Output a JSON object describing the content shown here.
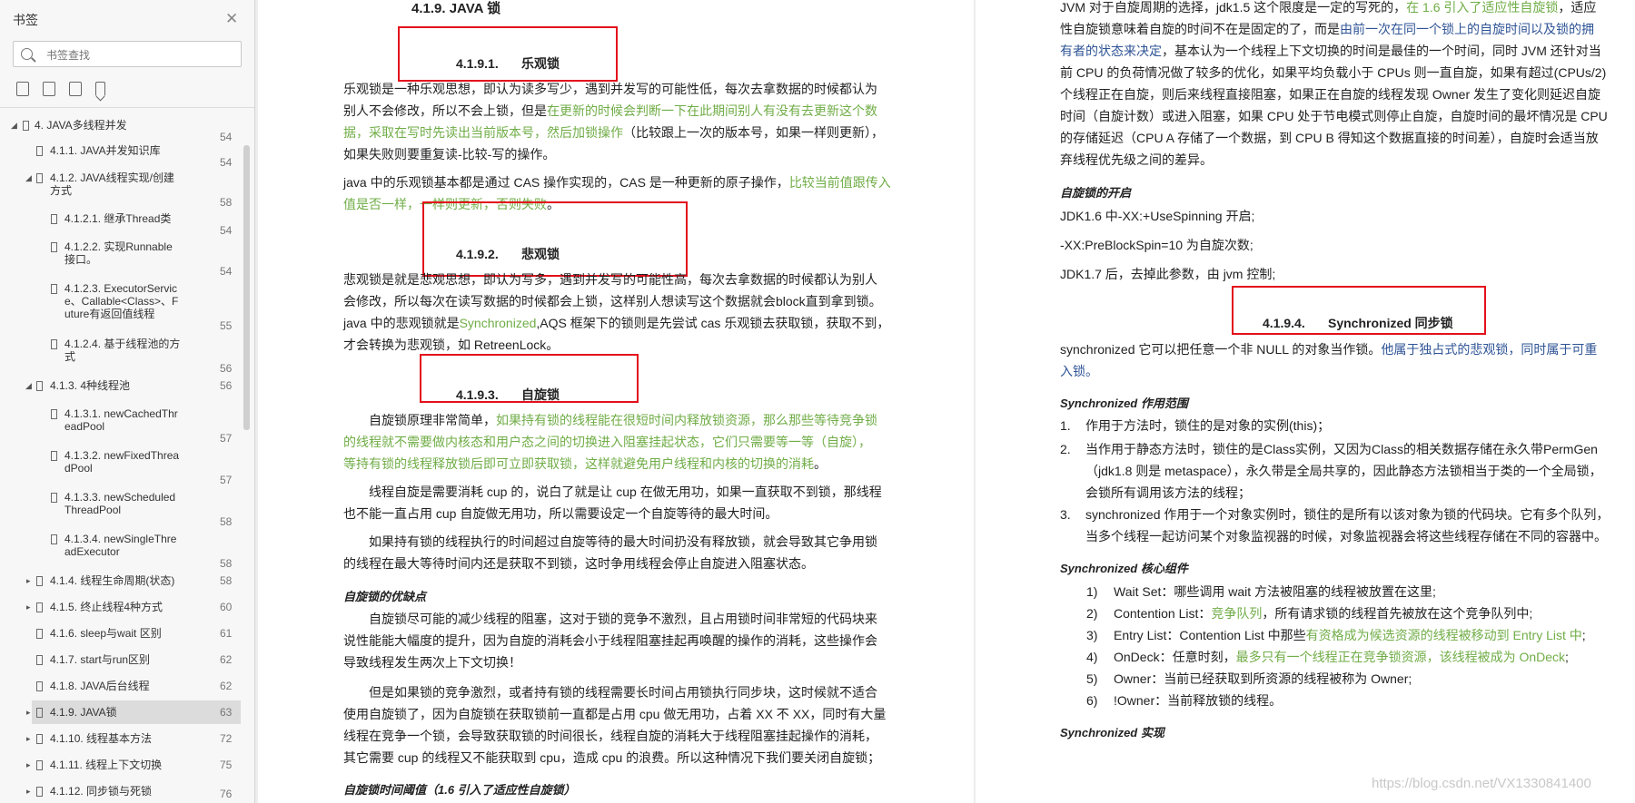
{
  "sidebar": {
    "title": "书签",
    "close_icon": "close-icon",
    "search_placeholder": "书签查找",
    "tools": [
      "expand-all-icon",
      "collapse-all-icon",
      "add-bookmark-icon",
      "bookmark-icon"
    ],
    "items": [
      {
        "label": "4. JAVA多线程并发",
        "page": "54",
        "arrow": "◢"
      },
      {
        "label": "4.1.1. JAVA并发知识库",
        "page": "54",
        "arrow": ""
      },
      {
        "label": "4.1.2. JAVA线程实现/创建",
        "label2": "方式",
        "page": "58",
        "arrow": "◢"
      },
      {
        "label": "4.1.2.1. 继承Thread类",
        "page": "54",
        "arrow": ""
      },
      {
        "label": "4.1.2.2. 实现Runnable",
        "label2": "接口。",
        "page": "54",
        "arrow": ""
      },
      {
        "label": "4.1.2.3. ExecutorServic",
        "label2": "e、Callable<Class>、F",
        "label3": "uture有返回值线程",
        "page": "55",
        "arrow": ""
      },
      {
        "label": "4.1.2.4. 基于线程池的方",
        "label2": "式",
        "page": "56",
        "arrow": ""
      },
      {
        "label": "4.1.3. 4种线程池",
        "page": "56",
        "arrow": "◢"
      },
      {
        "label": "4.1.3.1. newCachedThr",
        "label2": "eadPool",
        "page": "57",
        "arrow": ""
      },
      {
        "label": "4.1.3.2. newFixedThrea",
        "label2": "dPool",
        "page": "57",
        "arrow": ""
      },
      {
        "label": "4.1.3.3. newScheduled",
        "label2": "ThreadPool",
        "page": "58",
        "arrow": ""
      },
      {
        "label": "4.1.3.4. newSingleThre",
        "label2": "adExecutor",
        "page": "58",
        "arrow": ""
      },
      {
        "label": "4.1.4. 线程生命周期(状态)",
        "page": "58",
        "arrow": "▸"
      },
      {
        "label": "4.1.5. 终止线程4种方式",
        "page": "60",
        "arrow": "▸"
      },
      {
        "label": "4.1.6. sleep与wait 区别",
        "page": "61",
        "arrow": ""
      },
      {
        "label": "4.1.7. start与run区别",
        "page": "62",
        "arrow": ""
      },
      {
        "label": "4.1.8. JAVA后台线程",
        "page": "62",
        "arrow": ""
      },
      {
        "label": "4.1.9. JAVA锁",
        "page": "63",
        "arrow": "▸"
      },
      {
        "label": "4.1.10. 线程基本方法",
        "page": "72",
        "arrow": "▸"
      },
      {
        "label": "4.1.11. 线程上下文切换",
        "page": "75",
        "arrow": "▸"
      },
      {
        "label": "4.1.12. 同步锁与死锁",
        "page": "76",
        "arrow": "▸"
      }
    ]
  },
  "page1": {
    "top_heading": "4.1.9.  JAVA 锁",
    "h_optimistic_num": "4.1.9.1.",
    "h_optimistic": "乐观锁",
    "p1_a": "乐观锁是一种乐观思想，即认为读多写少，遇到并发写的可能性低，每次去拿数据的时候都认为",
    "p1_b1": "别人不会修改，所以不会上锁，但是",
    "p1_b2": "在更新的时候会判断一下在此期间别人有没有去更新这个数",
    "p1_c1": "据，采取在写时先读出当前版本号，然后加锁操作",
    "p1_c2": "（比较跟上一次的版本号，如果一样则更新），",
    "p1_d": "如果失败则要重复读-比较-写的操作。",
    "p2_a1": "java 中的乐观锁基本都是通过 CAS 操作实现的，CAS 是一种更新的原子操作，",
    "p2_a2": "比较当前值跟传入",
    "p2_b1": "值是否一样，一样则更新，否则失败",
    "p2_b2": "。",
    "h_pessimistic_num": "4.1.9.2.",
    "h_pessimistic": "悲观锁",
    "p3_a": "悲观锁是就是悲观思想，即认为写多，遇到并发写的可能性高，每次去拿数据的时候都认为别人",
    "p3_b": "会修改，所以每次在读写数据的时候都会上锁，这样别人想读写这个数据就会block直到拿到锁。",
    "p3_c1": "java 中的悲观锁就是",
    "p3_c2": "Synchronized",
    "p3_c3": ",AQS 框架下的锁则是先尝试 cas 乐观锁去获取锁，获取不到，",
    "p3_d": "才会转换为悲观锁，如 RetreenLock。",
    "h_spin_num": "4.1.9.3.",
    "h_spin": "自旋锁",
    "p4_a1": "自旋锁原理非常简单，",
    "p4_a2": "如果持有锁的线程能在很短时间内释放锁资源，那么那些等待竞争锁",
    "p4_b": "的线程就不需要做内核态和用户态之间的切换进入阻塞挂起状态，它们只需要等一等（自旋），",
    "p4_c1": "等持有锁的线程释放锁后即可立即获取锁，这样就避免用户线程和内核的切换的消耗",
    "p4_c2": "。",
    "p5_a": "线程自旋是需要消耗 cup 的，说白了就是让 cup 在做无用功，如果一直获取不到锁，那线程",
    "p5_b": "也不能一直占用 cup 自旋做无用功，所以需要设定一个自旋等待的最大时间。",
    "p6_a": "如果持有锁的线程执行的时间超过自旋等待的最大时间扔没有释放锁，就会导致其它争用锁",
    "p6_b": "的线程在最大等待时间内还是获取不到锁，这时争用线程会停止自旋进入阻塞状态。",
    "sub_pros": "自旋锁的优缺点",
    "p7_a": "自旋锁尽可能的减少线程的阻塞，这对于锁的竞争不激烈，且占用锁时间非常短的代码块来",
    "p7_b": "说性能能大幅度的提升，因为自旋的消耗会小于线程阻塞挂起再唤醒的操作的消耗，这些操作会",
    "p7_c": "导致线程发生两次上下文切换！",
    "p8_a": "但是如果锁的竞争激烈，或者持有锁的线程需要长时间占用锁执行同步块，这时候就不适合",
    "p8_b": "使用自旋锁了，因为自旋锁在获取锁前一直都是占用 cpu 做无用功，占着 XX 不 XX，同时有大量",
    "p8_c": "线程在竞争一个锁，会导致获取锁的时间很长，线程自旋的消耗大于线程阻塞挂起操作的消耗，",
    "p8_d": "其它需要 cup 的线程又不能获取到 cpu，造成 cpu 的浪费。所以这种情况下我们要关闭自旋锁；",
    "sub_threshold": "自旋锁时间阈值（1.6 引入了适应性自旋锁）"
  },
  "page2": {
    "q1_a1": "JVM 对于自旋周期的选择，jdk1.5 这个限度是一定的写死的，",
    "q1_a2": "在 1.6 引入了适应性自旋锁",
    "q1_a3": "，适应",
    "q1_b1": "性自旋锁意味着自旋的时间不在是固定的了，而是",
    "q1_b2": "由前一次在同一个锁上的自旋时间以及锁的拥",
    "q1_c1": "有者的状态来决定",
    "q1_c2": "，基本认为一个线程上下文切换的时间是最佳的一个时间，同时 JVM 还针对当",
    "q1_d": "前 CPU 的负荷情况做了较多的优化，如果平均负载小于 CPUs 则一直自旋，如果有超过(CPUs/2)",
    "q1_e": "个线程正在自旋，则后来线程直接阻塞，如果正在自旋的线程发现 Owner 发生了变化则延迟自旋",
    "q1_f": "时间（自旋计数）或进入阻塞，如果 CPU 处于节电模式则停止自旋，自旋时间的最坏情况是 CPU",
    "q1_g": "的存储延迟（CPU A 存储了一个数据，到 CPU B 得知这个数据直接的时间差），自旋时会适当放",
    "q1_h": "弃线程优先级之间的差异。",
    "sub_enable": "自旋锁的开启",
    "q2": "JDK1.6 中-XX:+UseSpinning 开启;",
    "q3": "-XX:PreBlockSpin=10 为自旋次数;",
    "q4": "JDK1.7 后，去掉此参数，由 jvm 控制;",
    "h_sync_num": "4.1.9.4.",
    "h_sync": "Synchronized 同步锁",
    "q5_a1": "synchronized 它可以把任意一个非 NULL 的对象当作锁。",
    "q5_a2": "他属于独占式的悲观锁，同时属于可重",
    "q5_b": "入锁。",
    "sub_scope": "Synchronized 作用范围",
    "scope": [
      {
        "n": "1.",
        "t": "作用于方法时，锁住的是对象的实例(this)；"
      },
      {
        "n": "2.",
        "t": "当作用于静态方法时，锁住的是Class实例，又因为Class的相关数据存储在永久带PermGen"
      },
      {
        "n": "",
        "t": "（jdk1.8 则是 metaspace），永久带是全局共享的，因此静态方法锁相当于类的一个全局锁，"
      },
      {
        "n": "",
        "t": "会锁所有调用该方法的线程；"
      },
      {
        "n": "3.",
        "t": "synchronized 作用于一个对象实例时，锁住的是所有以该对象为锁的代码块。它有多个队列，"
      },
      {
        "n": "",
        "t": "当多个线程一起访问某个对象监视器的时候，对象监视器会将这些线程存储在不同的容器中。"
      }
    ],
    "sub_core": "Synchronized 核心组件",
    "core": [
      {
        "n": "1)",
        "a": "Wait Set：哪些调用 wait 方法被阻塞的线程被放置在这里;",
        "g": "",
        "c": ""
      },
      {
        "n": "2)",
        "a": "Contention List：",
        "g": "竞争队列",
        "c": "，所有请求锁的线程首先被放在这个竞争队列中;"
      },
      {
        "n": "3)",
        "a": "Entry List：Contention List 中那些",
        "g": "有资格成为候选资源的线程被移动到 Entry List 中",
        "c": ";"
      },
      {
        "n": "4)",
        "a": "OnDeck：任意时刻，",
        "g": "最多只有一个线程正在竞争锁资源，该线程被成为 OnDeck",
        "c": ";"
      },
      {
        "n": "5)",
        "a": "Owner：当前已经获取到所资源的线程被称为 Owner;",
        "g": "",
        "c": ""
      },
      {
        "n": "6)",
        "a": "!Owner：当前释放锁的线程。",
        "g": "",
        "c": ""
      }
    ],
    "sub_impl": "Synchronized 实现",
    "watermark": "https://blog.csdn.net/VX1330841400"
  }
}
